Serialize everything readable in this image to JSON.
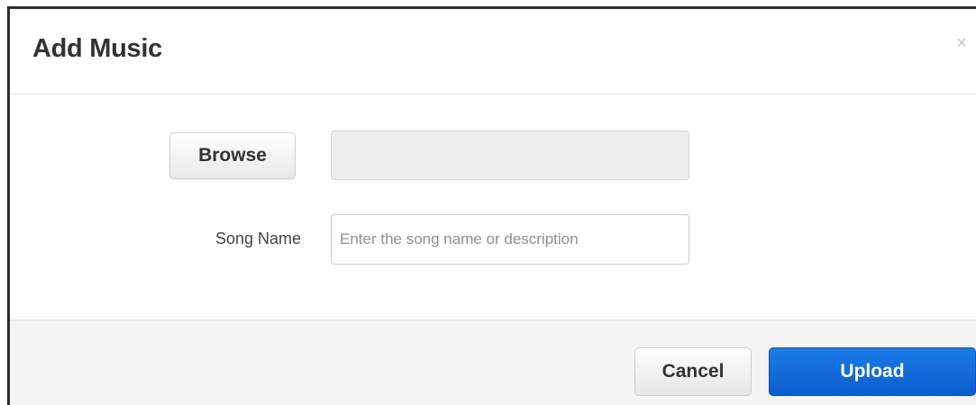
{
  "dialog": {
    "title": "Add Music",
    "close_glyph": "×"
  },
  "body": {
    "browse_label": "Browse",
    "selected_file": "",
    "song_name_label": "Song Name",
    "song_name_value": "",
    "song_name_placeholder": "Enter the song name or description"
  },
  "footer": {
    "cancel_label": "Cancel",
    "upload_label": "Upload"
  },
  "colors": {
    "primary": "#0c5ccc",
    "footer_bg": "#f5f5f5"
  }
}
